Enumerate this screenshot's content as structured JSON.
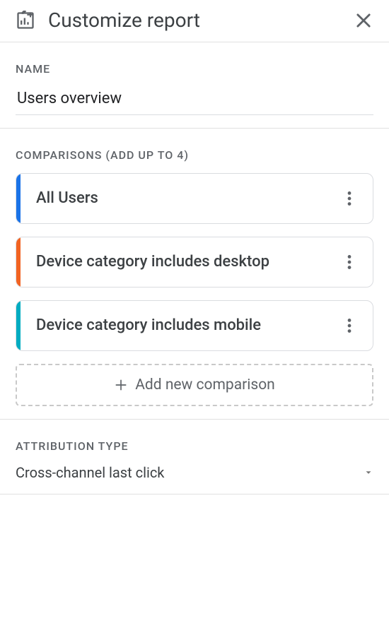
{
  "header": {
    "title": "Customize report"
  },
  "name": {
    "label": "NAME",
    "value": "Users overview"
  },
  "comparisons": {
    "label": "COMPARISONS (ADD UP TO 4)",
    "items": [
      {
        "label": "All Users"
      },
      {
        "label": "Device category includes desktop"
      },
      {
        "label": "Device category includes mobile"
      }
    ],
    "add_label": "Add new comparison"
  },
  "attribution": {
    "label": "ATTRIBUTION TYPE",
    "value": "Cross-channel last click"
  }
}
